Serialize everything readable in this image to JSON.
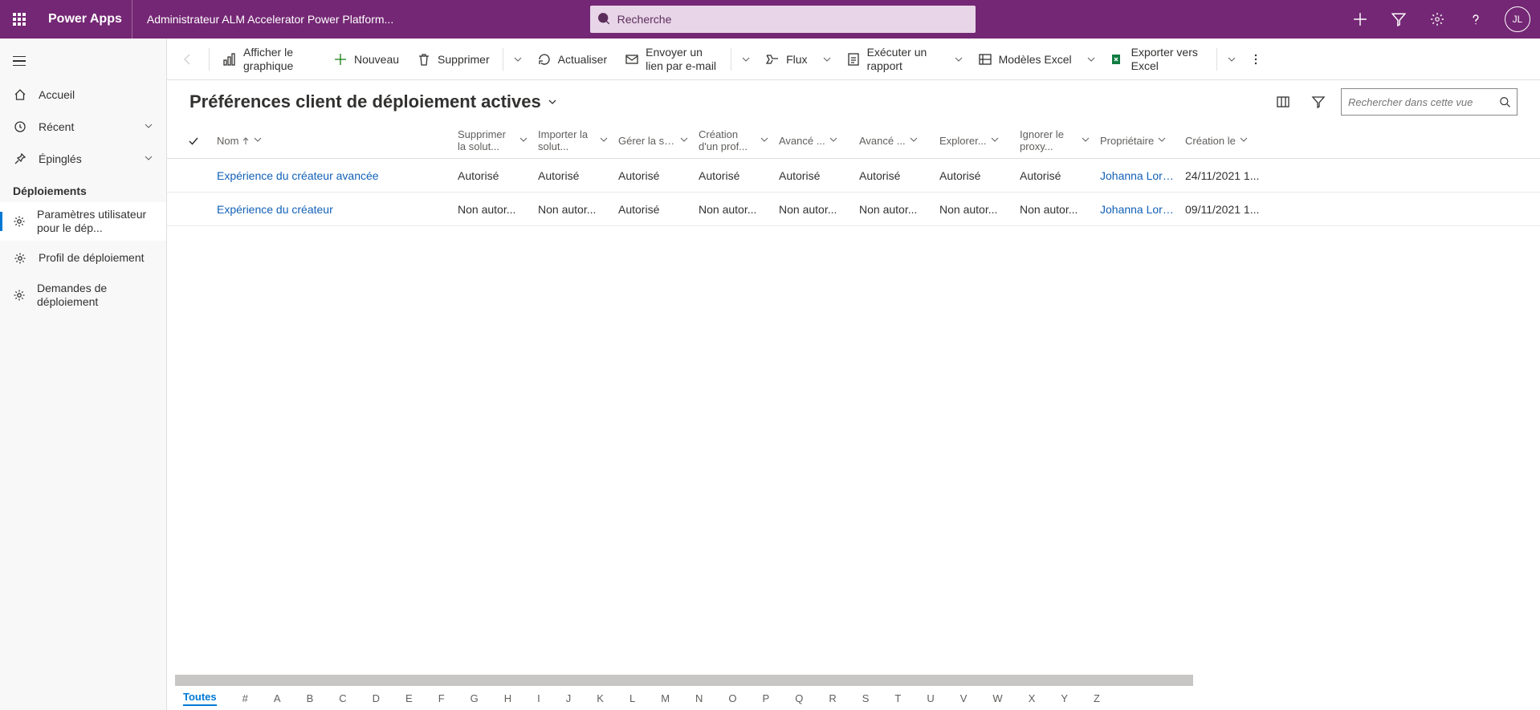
{
  "header": {
    "brand": "Power Apps",
    "app_title": "Administrateur ALM Accelerator Power Platform...",
    "search_placeholder": "Recherche",
    "avatar_initials": "JL"
  },
  "sidebar": {
    "home": "Accueil",
    "recent": "Récent",
    "pinned": "Épinglés",
    "section": "Déploiements",
    "items": [
      "Paramètres utilisateur pour le dép...",
      "Profil de déploiement",
      "Demandes de déploiement"
    ]
  },
  "commands": {
    "chart": "Afficher le graphique",
    "new": "Nouveau",
    "delete": "Supprimer",
    "refresh": "Actualiser",
    "email": "Envoyer un lien par e-mail",
    "flow": "Flux",
    "report": "Exécuter un rapport",
    "templates": "Modèles Excel",
    "export": "Exporter vers Excel"
  },
  "view": {
    "title": "Préférences client de déploiement actives",
    "search_placeholder": "Rechercher dans cette vue"
  },
  "columns": {
    "name": "Nom",
    "c1": "Supprimer la solut...",
    "c2": "Importer la solut...",
    "c3": "Gérer la solut...",
    "c4": "Création d'un prof...",
    "c5": "Avancé ...",
    "c6": "Avancé ...",
    "c7": "Explorer...",
    "c8": "Ignorer le proxy...",
    "owner": "Propriétaire",
    "created": "Création le"
  },
  "rows": [
    {
      "name": "Expérience du créateur avancée",
      "c1": "Autorisé",
      "c2": "Autorisé",
      "c3": "Autorisé",
      "c4": "Autorisé",
      "c5": "Autorisé",
      "c6": "Autorisé",
      "c7": "Autorisé",
      "c8": "Autorisé",
      "owner": "Johanna Loren :",
      "created": "24/11/2021 1..."
    },
    {
      "name": "Expérience du créateur",
      "c1": "Non autor...",
      "c2": "Non autor...",
      "c3": "Autorisé",
      "c4": "Non autor...",
      "c5": "Non autor...",
      "c6": "Non autor...",
      "c7": "Non autor...",
      "c8": "Non autor...",
      "owner": "Johanna Loren :",
      "created": "09/11/2021 1..."
    }
  ],
  "alpha": {
    "all": "Toutes",
    "hash": "#",
    "letters": [
      "A",
      "B",
      "C",
      "D",
      "E",
      "F",
      "G",
      "H",
      "I",
      "J",
      "K",
      "L",
      "M",
      "N",
      "O",
      "P",
      "Q",
      "R",
      "S",
      "T",
      "U",
      "V",
      "W",
      "X",
      "Y",
      "Z"
    ]
  }
}
